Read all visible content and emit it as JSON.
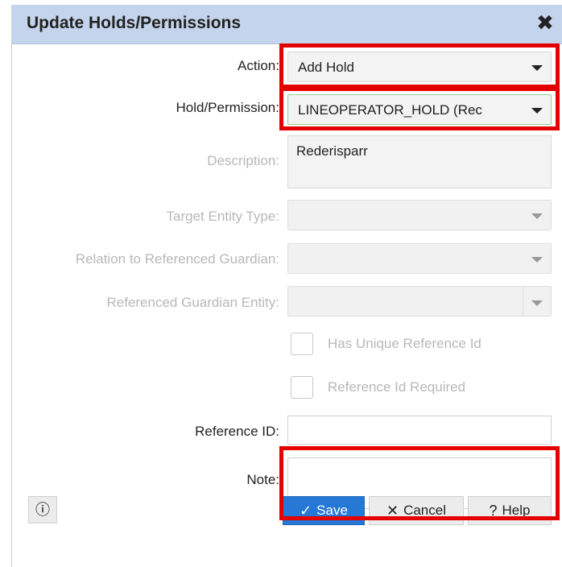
{
  "dialog": {
    "title": "Update Holds/Permissions"
  },
  "fields": {
    "action": {
      "label": "Action:",
      "value": "Add Hold"
    },
    "hold_permission": {
      "label": "Hold/Permission:",
      "value": "LINEOPERATOR_HOLD (Rec"
    },
    "description": {
      "label": "Description:",
      "value": "Rederisparr"
    },
    "target_entity_type": {
      "label": "Target Entity Type:",
      "value": ""
    },
    "relation_guardian": {
      "label": "Relation to Referenced Guardian:",
      "value": ""
    },
    "ref_guardian_entity": {
      "label": "Referenced Guardian Entity:",
      "value": ""
    },
    "has_unique_ref": {
      "label": "Has Unique Reference Id",
      "checked": false
    },
    "ref_id_required": {
      "label": "Reference Id Required",
      "checked": false
    },
    "reference_id": {
      "label": "Reference ID:",
      "value": ""
    },
    "note": {
      "label": "Note:",
      "value": ""
    }
  },
  "buttons": {
    "save": "Save",
    "cancel": "Cancel",
    "help": "Help"
  },
  "icons": {
    "close": "close-icon",
    "info": "info-icon",
    "save": "check-icon",
    "cancel": "x-icon",
    "help": "question-circle-icon"
  },
  "colors": {
    "titlebar": "#c4d4ec",
    "highlight": "#e50000",
    "primary": "#2678d6"
  }
}
